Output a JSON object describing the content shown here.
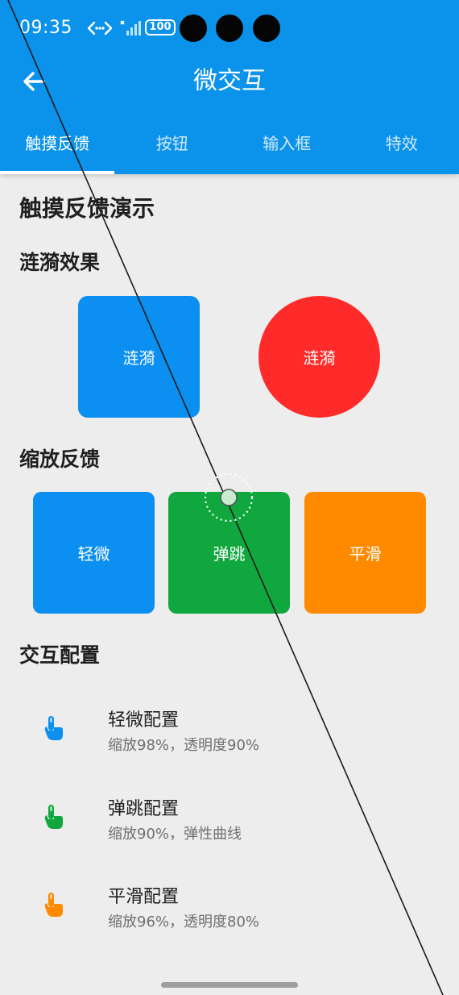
{
  "status": {
    "time": "09:35",
    "battery": "100"
  },
  "appbar": {
    "title": "微交互",
    "back_icon": "arrow-left-icon"
  },
  "tabs": [
    {
      "label": "触摸反馈",
      "active": true
    },
    {
      "label": "按钮",
      "active": false
    },
    {
      "label": "输入框",
      "active": false
    },
    {
      "label": "特效",
      "active": false
    }
  ],
  "main": {
    "heading": "触摸反馈演示",
    "ripple": {
      "title": "涟漪效果",
      "square_label": "涟漪",
      "circle_label": "涟漪"
    },
    "scale": {
      "title": "缩放反馈",
      "items": [
        {
          "label": "轻微"
        },
        {
          "label": "弹跳"
        },
        {
          "label": "平滑"
        }
      ]
    },
    "config": {
      "title": "交互配置",
      "items": [
        {
          "title": "轻微配置",
          "subtitle": "缩放98%，透明度90%",
          "icon": "touch-hand-icon"
        },
        {
          "title": "弹跳配置",
          "subtitle": "缩放90%，弹性曲线",
          "icon": "touch-hand-icon"
        },
        {
          "title": "平滑配置",
          "subtitle": "缩放96%，透明度80%",
          "icon": "touch-hand-icon"
        }
      ]
    }
  },
  "colors": {
    "appbar": "#0b92ea",
    "blue": "#0b8ff0",
    "red": "#ff2b2b",
    "green": "#10a83e",
    "orange": "#ff8a00",
    "background": "#ededed"
  }
}
